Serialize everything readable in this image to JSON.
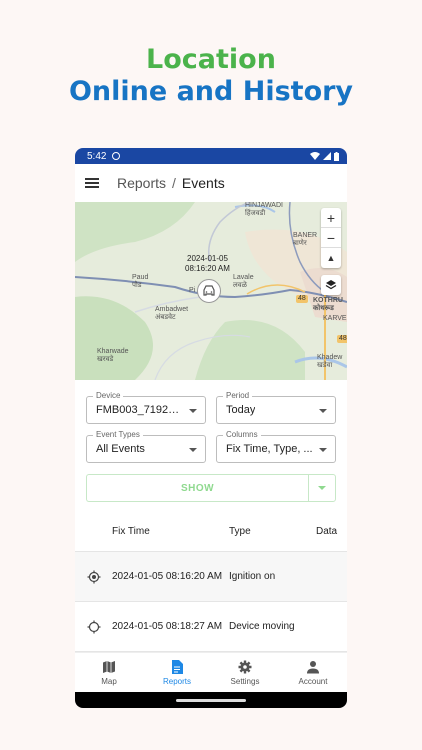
{
  "headline": {
    "line1": "Location",
    "line2": "Online and History"
  },
  "status": {
    "time": "5:42"
  },
  "appbar": {
    "breadcrumb_parent": "Reports",
    "separator": "/",
    "breadcrumb_current": "Events"
  },
  "map": {
    "marker_time_line1": "2024-01-05",
    "marker_time_line2": "08:16:20 AM",
    "labels": {
      "hinjawadi": "HINJAWADI",
      "hinjawadi_local": "हिंजवडी",
      "baner": "BANER",
      "baner_local": "बाणेर",
      "paud": "Paud",
      "paud_local": "पौड",
      "lavale": "Lavale",
      "lavale_local": "लवळे",
      "pirangut": "Pi",
      "ambadwet": "Ambadwet",
      "ambadwet_local": "अंबडवेट",
      "kothrud": "KOTHRU",
      "kothrud_local": "कोथरूड",
      "karve": "KARVE",
      "kharwade": "Kharwade",
      "kharwade_local": "खरवडे",
      "khadew": "Khadew",
      "khadew_local": "खडेवा",
      "road48": "48"
    },
    "zoom_in": "+",
    "zoom_out": "−",
    "compass": "▲"
  },
  "form": {
    "device": {
      "label": "Device",
      "value": "FMB003_71926..."
    },
    "period": {
      "label": "Period",
      "value": "Today"
    },
    "event_types": {
      "label": "Event Types",
      "value": "All Events"
    },
    "columns": {
      "label": "Columns",
      "value": "Fix Time, Type, ..."
    },
    "show_label": "SHOW"
  },
  "table": {
    "headers": [
      "Fix Time",
      "Type",
      "Data"
    ],
    "rows": [
      {
        "fix_time": "2024-01-05 08:16:20 AM",
        "type": "Ignition on"
      },
      {
        "fix_time": "2024-01-05 08:18:27 AM",
        "type": "Device moving"
      }
    ]
  },
  "nav": {
    "items": [
      {
        "label": "Map",
        "icon": "map-icon"
      },
      {
        "label": "Reports",
        "icon": "reports-icon"
      },
      {
        "label": "Settings",
        "icon": "gear-icon"
      },
      {
        "label": "Account",
        "icon": "account-icon"
      }
    ]
  },
  "colors": {
    "accent_green": "#4bb34b",
    "accent_blue": "#1774c4",
    "status_bar": "#1a47a3",
    "nav_active": "#1e88e5"
  }
}
